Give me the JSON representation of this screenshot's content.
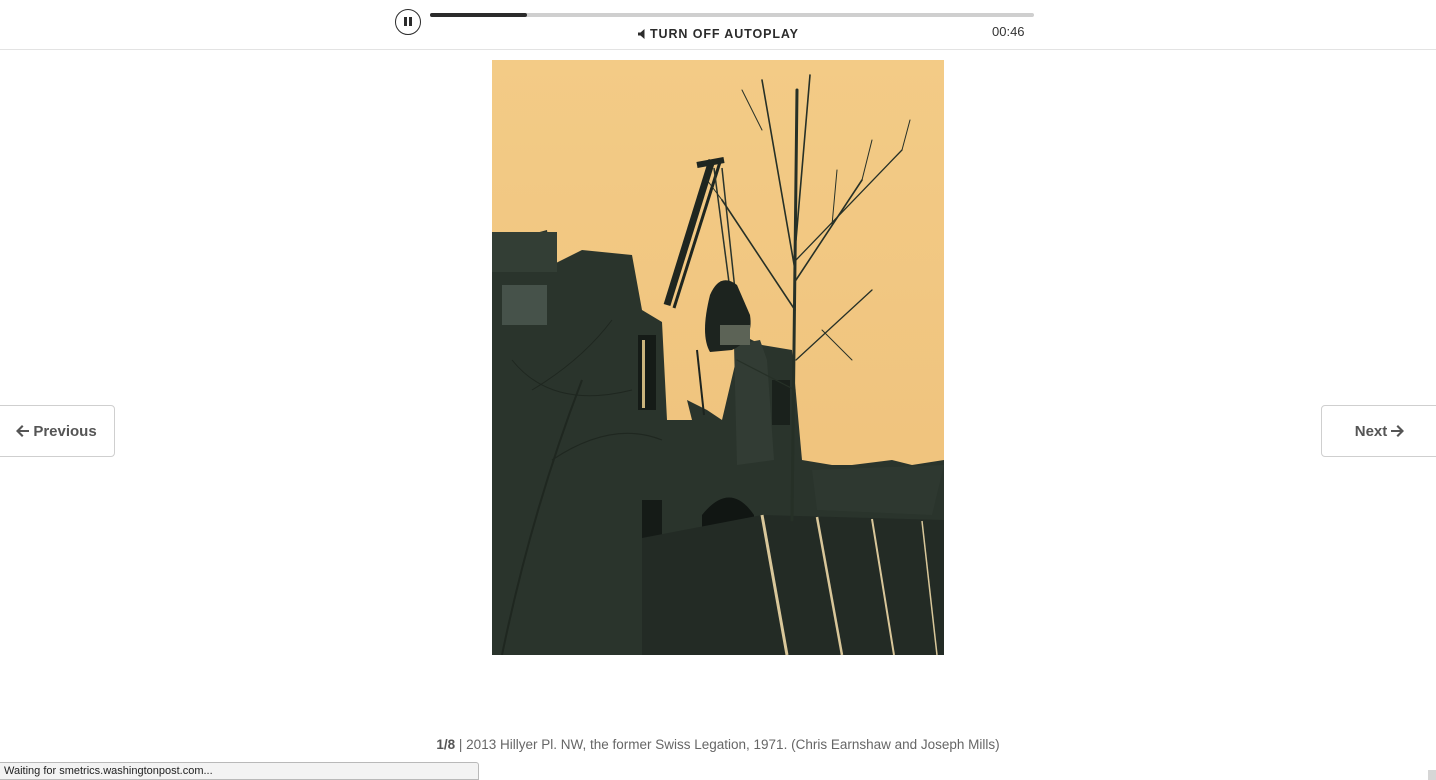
{
  "player": {
    "pause_icon": "pause-icon",
    "progress_fraction": 0.16,
    "autoplay_icon": "speaker-icon",
    "autoplay_label": "TURN OFF AUTOPLAY",
    "time": "00:46"
  },
  "slide": {
    "image_alt": "Sepia photograph of a crane with a wrecking claw demolishing a brick building beside a bare tree",
    "counter": "1/8",
    "separator": "|",
    "caption": "2013 Hillyer Pl. NW, the former Swiss Legation, 1971. (Chris Earnshaw and Joseph Mills)"
  },
  "nav": {
    "previous_label": "Previous",
    "previous_icon": "arrow-left-icon",
    "next_label": "Next",
    "next_icon": "arrow-right-icon"
  },
  "status": {
    "text": "Waiting for smetrics.washingtonpost.com..."
  },
  "colors": {
    "photo_background": "#f2c882",
    "photo_ink": "#283228",
    "text_dark": "#2b2b2b",
    "border": "#cfcfcf"
  }
}
